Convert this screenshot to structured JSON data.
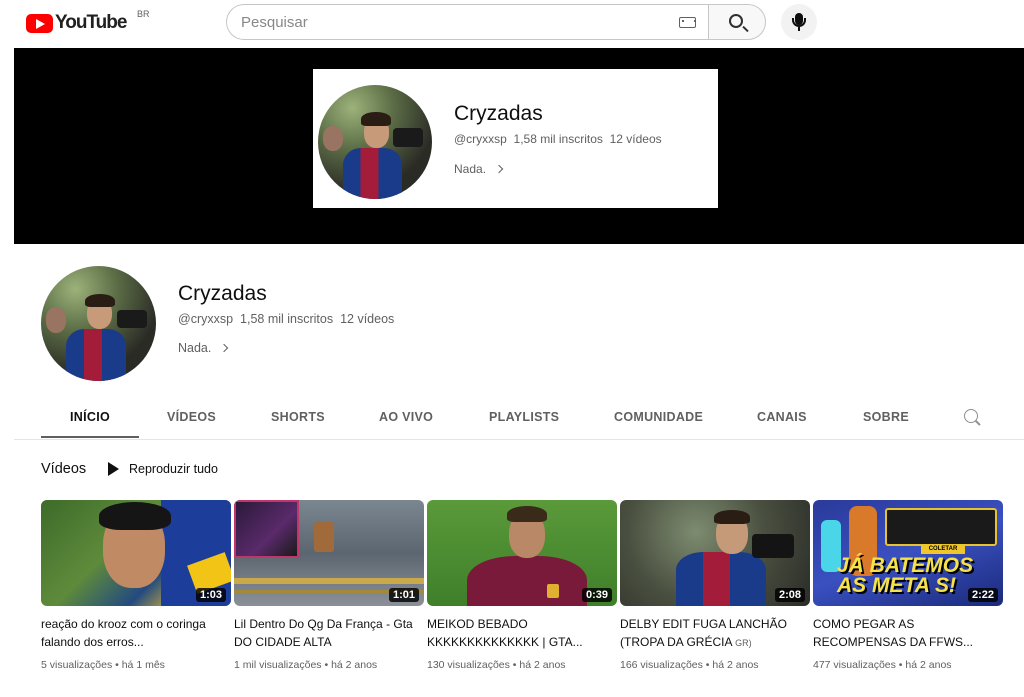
{
  "header": {
    "logo_text": "YouTube",
    "country_code": "BR",
    "search_placeholder": "Pesquisar"
  },
  "channel": {
    "name": "Cryzadas",
    "handle": "@cryxxsp",
    "subscribers": "1,58 mil inscritos",
    "video_count": "12 vídeos",
    "description": "Nada."
  },
  "tabs": [
    {
      "label": "INÍCIO",
      "active": true
    },
    {
      "label": "VÍDEOS",
      "active": false
    },
    {
      "label": "SHORTS",
      "active": false
    },
    {
      "label": "AO VIVO",
      "active": false
    },
    {
      "label": "PLAYLISTS",
      "active": false
    },
    {
      "label": "COMUNIDADE",
      "active": false
    },
    {
      "label": "CANAIS",
      "active": false
    },
    {
      "label": "SOBRE",
      "active": false
    }
  ],
  "section": {
    "title": "Vídeos",
    "play_all": "Reproduzir tudo"
  },
  "videos": [
    {
      "title": "reação do krooz com o coringa falando dos erros...",
      "duration": "1:03",
      "views": "5 visualizações",
      "age": "há 1 mês"
    },
    {
      "title": "Lil Dentro Do Qg Da França - Gta DO CIDADE ALTA",
      "duration": "1:01",
      "views": "1 mil visualizações",
      "age": "há 2 anos"
    },
    {
      "title": "MEIKOD BEBADO KKKKKKKKKKKKKK | GTA...",
      "duration": "0:39",
      "views": "130 visualizações",
      "age": "há 2 anos"
    },
    {
      "title": "DELBY EDIT FUGA LANCHÃO (TROPA DA GRÉCIA",
      "title_suffix": "GR)",
      "duration": "2:08",
      "views": "166 visualizações",
      "age": "há 2 anos"
    },
    {
      "title": "COMO PEGAR AS RECOMPENSAS DA FFWS...",
      "duration": "2:22",
      "views": "477 visualizações",
      "age": "há 2 anos",
      "thumb_text_1": "JÁ BATEMOS",
      "thumb_text_2": "AS META S!",
      "thumb_button": "COLETAR"
    }
  ]
}
